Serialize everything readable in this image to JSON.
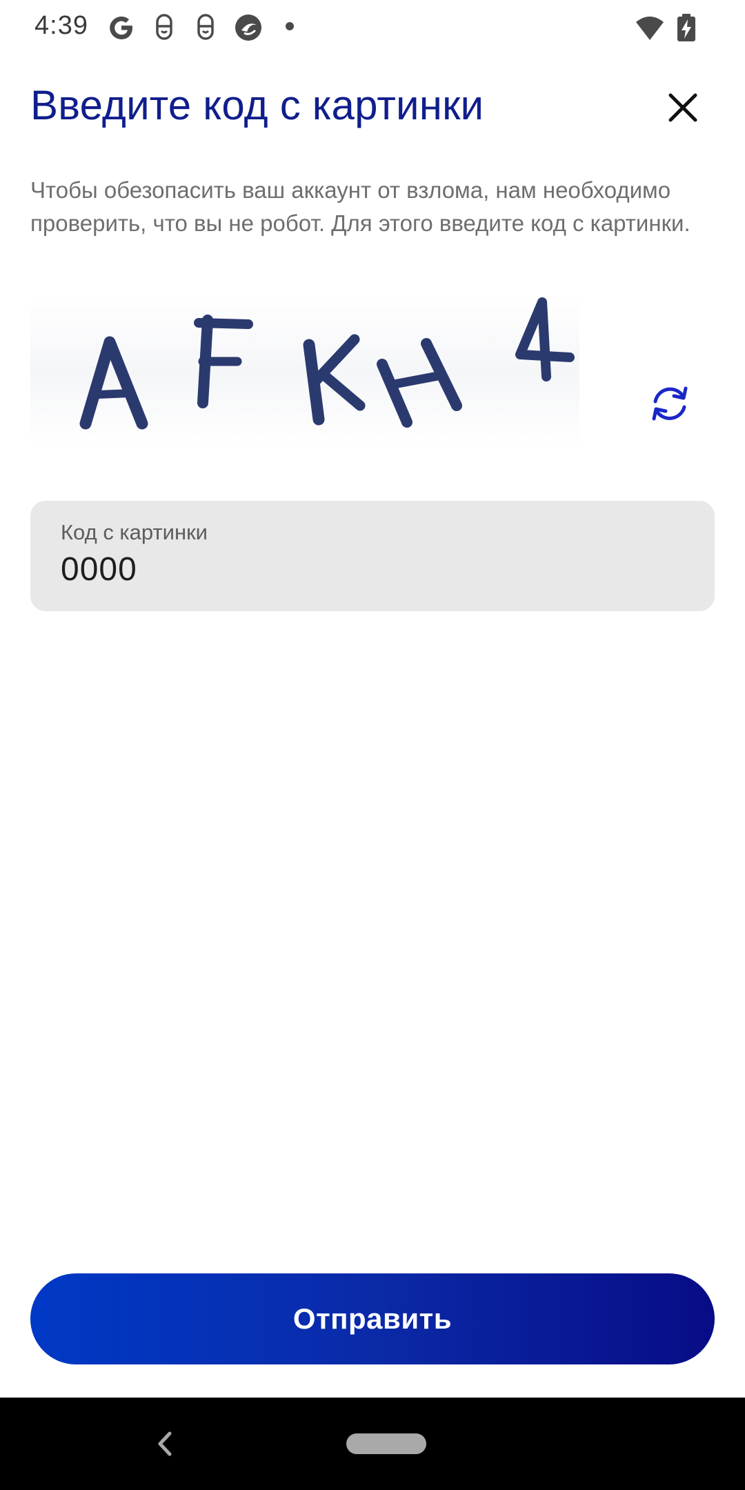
{
  "status_bar": {
    "time": "4:39",
    "icons": [
      "google-icon",
      "notification-app-icon",
      "notification-app-icon",
      "app-logo-icon",
      "more-dot-icon",
      "wifi-icon",
      "battery-charging-icon"
    ]
  },
  "header": {
    "title": "Введите код с картинки",
    "close_icon": "close-icon"
  },
  "description": "Чтобы обезопасить ваш аккаунт от взлома, нам необходимо проверить, что вы не робот. Для этого введите код с картинки.",
  "captcha": {
    "text": "AFKH4",
    "refresh_icon": "refresh-icon",
    "accent_color": "#1a27c8"
  },
  "code_field": {
    "label": "Код с картинки",
    "value": "0000"
  },
  "submit_button": {
    "label": "Отправить"
  },
  "nav_bar": {
    "back_icon": "back-chevron-icon",
    "home_icon": "home-pill-icon"
  },
  "colors": {
    "title": "#101e8c",
    "button_gradient_start": "#0039c6",
    "button_gradient_end": "#080c86",
    "field_background": "#e8e8e8"
  }
}
